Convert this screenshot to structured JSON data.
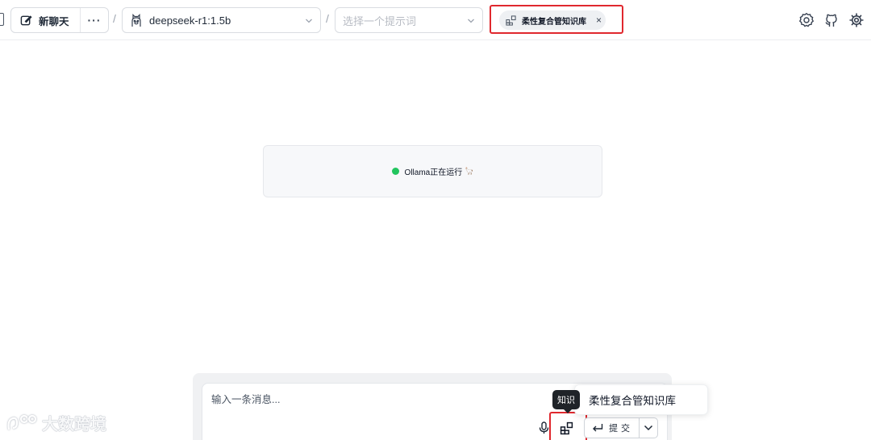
{
  "header": {
    "new_chat_label": "新聊天",
    "more_label": "···",
    "separator": "/",
    "model": "deepseek-r1:1.5b",
    "prompt_placeholder": "选择一个提示词",
    "knowledge_chip": "柔性复合管知识库",
    "chip_close": "×",
    "icons": [
      "settings-gear-icon",
      "github-icon",
      "cog-icon"
    ]
  },
  "status": {
    "text": "Ollama正在运行",
    "emoji": "🦙",
    "dot_color": "#22c55e"
  },
  "composer": {
    "placeholder": "输入一条消息...",
    "submit_label": "提交",
    "tooltip": "知识",
    "dropdown_item": "柔性复合管知识库"
  },
  "watermark": {
    "text": "大数跨境"
  },
  "colors": {
    "highlight": "#e0282e",
    "border": "#d9dce1",
    "accent_green": "#22c55e"
  }
}
